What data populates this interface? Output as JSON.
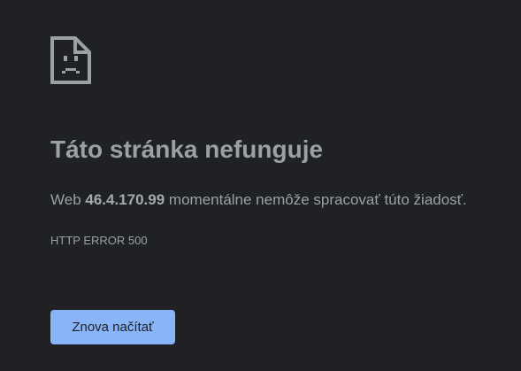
{
  "error_page": {
    "icon": "sad-page-icon",
    "title": "Táto stránka nefunguje",
    "message_prefix": "Web ",
    "host": "46.4.170.99",
    "message_suffix": " momentálne nemôže spracovať túto žiadosť.",
    "error_code": "HTTP ERROR 500",
    "reload_label": "Znova načítať"
  },
  "colors": {
    "background": "#202124",
    "text": "#9aa0a6",
    "button": "#8ab4f8",
    "button_text": "#202124"
  }
}
